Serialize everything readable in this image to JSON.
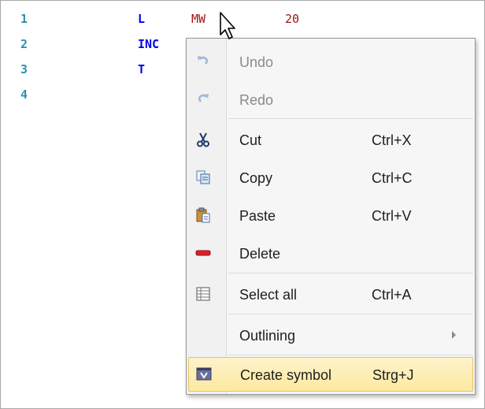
{
  "editor": {
    "lines": [
      {
        "num": "1",
        "op": "L",
        "arg": "MW",
        "val": "20"
      },
      {
        "num": "2",
        "op": "INC",
        "arg": "",
        "val": ""
      },
      {
        "num": "3",
        "op": "T",
        "arg": "",
        "val": ""
      },
      {
        "num": "4",
        "op": "",
        "arg": "",
        "val": ""
      }
    ]
  },
  "context_menu": {
    "items": [
      {
        "label": "Undo",
        "shortcut": "",
        "icon": "undo-icon",
        "enabled": false
      },
      {
        "label": "Redo",
        "shortcut": "",
        "icon": "redo-icon",
        "enabled": false
      },
      {
        "label": "Cut",
        "shortcut": "Ctrl+X",
        "icon": "scissors-icon",
        "enabled": true
      },
      {
        "label": "Copy",
        "shortcut": "Ctrl+C",
        "icon": "copy-icon",
        "enabled": true
      },
      {
        "label": "Paste",
        "shortcut": "Ctrl+V",
        "icon": "paste-icon",
        "enabled": true
      },
      {
        "label": "Delete",
        "shortcut": "",
        "icon": "delete-icon",
        "enabled": true
      },
      {
        "label": "Select all",
        "shortcut": "Ctrl+A",
        "icon": "select-all-icon",
        "enabled": true
      },
      {
        "label": "Outlining",
        "shortcut": "",
        "icon": "",
        "enabled": true,
        "submenu": true
      },
      {
        "label": "Create symbol",
        "shortcut": "Strg+J",
        "icon": "create-symbol-icon",
        "enabled": true,
        "highlighted": true
      }
    ]
  },
  "colors": {
    "line_number": "#2b91af",
    "keyword": "#0000ee",
    "operand": "#a31515",
    "menu_highlight": "#fde9a1"
  }
}
